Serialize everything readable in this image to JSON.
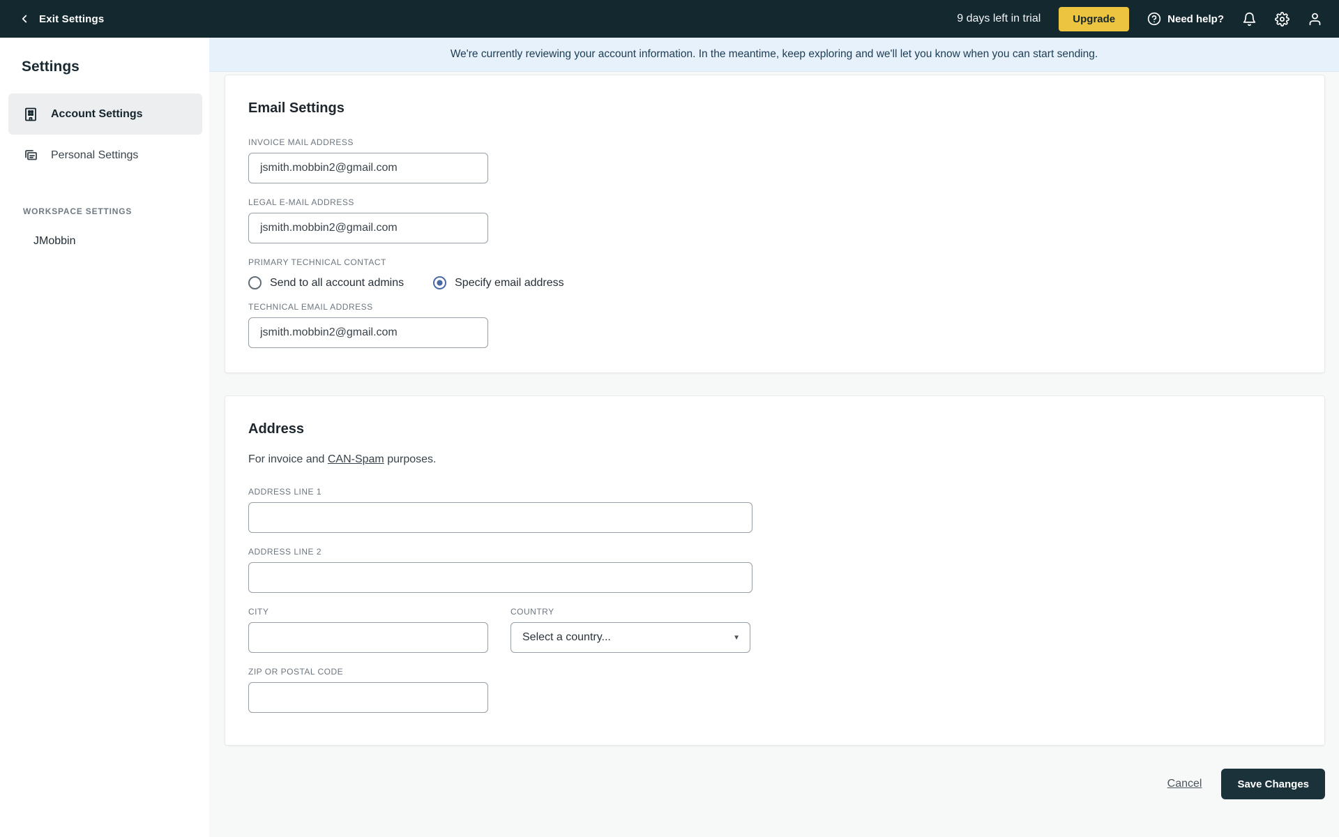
{
  "topbar": {
    "exit_label": "Exit Settings",
    "trial_text": "9 days left in trial",
    "upgrade_label": "Upgrade",
    "help_label": "Need help?"
  },
  "banner": {
    "text": "We're currently reviewing your account information. In the meantime, keep exploring and we'll let you know when you can start sending."
  },
  "sidebar": {
    "title": "Settings",
    "items": [
      {
        "label": "Account Settings",
        "active": true
      },
      {
        "label": "Personal Settings",
        "active": false
      }
    ],
    "section_label": "WORKSPACE SETTINGS",
    "workspace_item": "JMobbin"
  },
  "email_settings": {
    "title": "Email Settings",
    "invoice_label": "INVOICE MAIL ADDRESS",
    "invoice_value": "jsmith.mobbin2@gmail.com",
    "legal_label": "LEGAL E-MAIL ADDRESS",
    "legal_value": "jsmith.mobbin2@gmail.com",
    "contact_label": "PRIMARY TECHNICAL CONTACT",
    "radio_admins_label": "Send to all account admins",
    "radio_specify_label": "Specify email address",
    "selected_radio": "Specify email address",
    "technical_label": "TECHNICAL EMAIL ADDRESS",
    "technical_value": "jsmith.mobbin2@gmail.com"
  },
  "address": {
    "title": "Address",
    "desc_prefix": "For invoice and ",
    "desc_link": "CAN-Spam",
    "desc_suffix": " purposes.",
    "line1_label": "ADDRESS LINE 1",
    "line1_value": "",
    "line2_label": "ADDRESS LINE 2",
    "line2_value": "",
    "city_label": "CITY",
    "city_value": "",
    "country_label": "COUNTRY",
    "country_value": "Select a country...",
    "zip_label": "ZIP OR POSTAL CODE",
    "zip_value": ""
  },
  "actions": {
    "cancel_label": "Cancel",
    "save_label": "Save Changes"
  },
  "colors": {
    "topbar_bg": "#142830",
    "upgrade_yellow": "#ecc440",
    "banner_bg": "#e7f1fb",
    "banner_text": "#1c3c53",
    "radio_selected_blue": "#4a69a5",
    "save_button_bg": "#1b323b",
    "sidebar_active_bg": "#eceeef"
  }
}
